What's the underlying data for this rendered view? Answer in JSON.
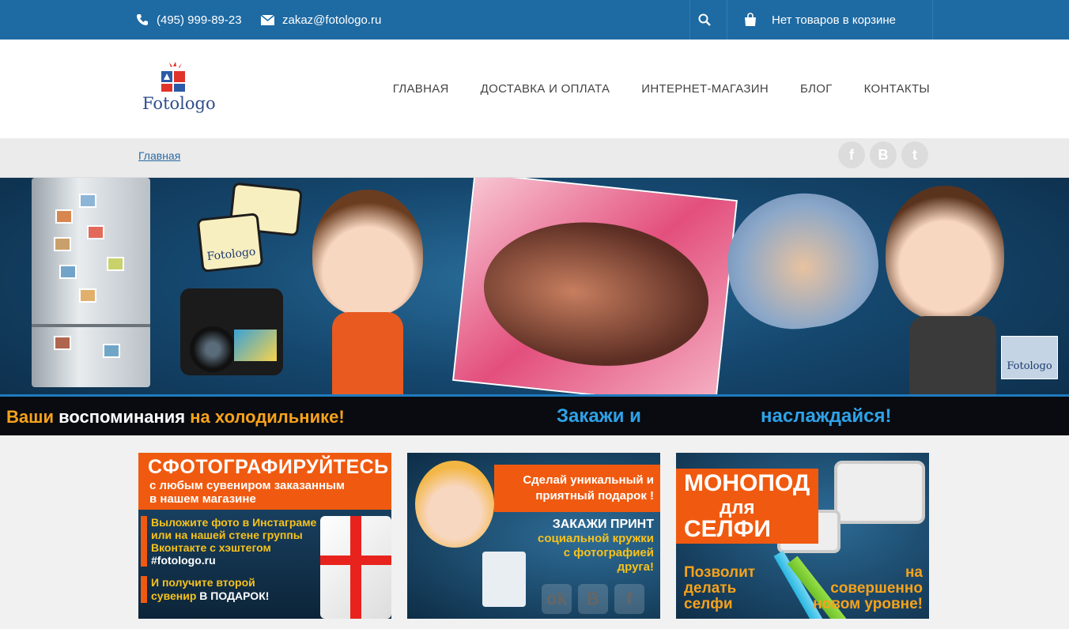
{
  "topbar": {
    "phone": "(495) 999-89-23",
    "email": "zakaz@fotologo.ru",
    "cart_text": "Нет товаров в корзине"
  },
  "header": {
    "logo_text": "Fotologo",
    "nav": [
      "ГЛАВНАЯ",
      "ДОСТАВКА И ОПЛАТА",
      "ИНТЕРНЕТ-МАГАЗИН",
      "БЛОГ",
      "КОНТАКТЫ"
    ]
  },
  "breadcrumb": {
    "home": "Главная"
  },
  "social": [
    "f",
    "B",
    "t"
  ],
  "hero": {
    "caption_left_1": "Ваши",
    "caption_left_2": "воспоминания",
    "caption_left_3": "на холодильнике!",
    "caption_mid": "Закажи и",
    "caption_right": "наслаждайся!",
    "badge_logo": "Fotologo",
    "card_logo": "Fotologo"
  },
  "promos": {
    "p1": {
      "title": "СФОТОГРАФИРУЙТЕСЬ",
      "subtitle_1": "с любым сувениром заказанным",
      "subtitle_2": "в нашем магазине",
      "body_1": "Выложите фото в Инстаграме",
      "body_2": "или на нашей стене группы",
      "body_3": "Вконтакте с хэштегом",
      "hashtag": "#fotologo.ru",
      "foot_1": "И получите второй",
      "foot_2": "сувенир",
      "foot_3": "В ПОДАРОК!"
    },
    "p2": {
      "banner_1": "Сделай уникальный и",
      "banner_2": "приятный подарок !",
      "line_1": "ЗАКАЖИ ПРИНТ",
      "line_2": "социальной кружки",
      "line_3": "с фотографией",
      "line_4": "друга!",
      "icons": [
        "ok",
        "B",
        "f"
      ]
    },
    "p3": {
      "title_1": "МОНОПОД",
      "title_2": "для",
      "title_3": "СЕЛФИ",
      "left_1": "Позволит",
      "left_2": "делать",
      "left_3": "селфи",
      "right_1": "на",
      "right_2": "совершенно",
      "right_3": "новом уровне!"
    }
  },
  "colors": {
    "topbar": "#1e6aa3",
    "accent_orange": "#f05a10",
    "accent_yellow": "#f7c21b",
    "link": "#2a6aa3"
  },
  "icons": {
    "phone": "phone-icon",
    "email": "envelope-icon",
    "search": "search-icon",
    "cart": "shopping-bag-icon"
  }
}
